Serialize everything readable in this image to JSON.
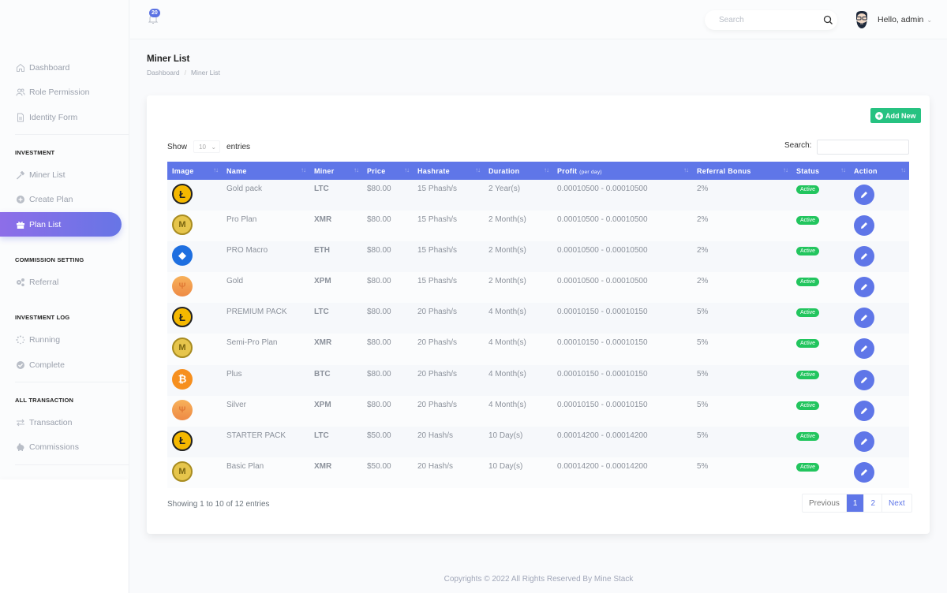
{
  "sidebar": {
    "top_items": [
      {
        "label": "Dashboard",
        "icon": "home-icon"
      },
      {
        "label": "Role Permission",
        "icon": "users-icon"
      },
      {
        "label": "Identity Form",
        "icon": "file-icon"
      }
    ],
    "sections": [
      {
        "title": "INVESTMENT",
        "items": [
          {
            "label": "Miner List",
            "icon": "hammer-icon"
          },
          {
            "label": "Create Plan",
            "icon": "plus-circle-icon"
          },
          {
            "label": "Plan List",
            "icon": "gift-icon",
            "active": true
          }
        ]
      },
      {
        "title": "COMMISSION SETTING",
        "items": [
          {
            "label": "Referral",
            "icon": "cogs-icon"
          }
        ]
      },
      {
        "title": "INVESTMENT LOG",
        "items": [
          {
            "label": "Running",
            "icon": "spinner-icon"
          },
          {
            "label": "Complete",
            "icon": "check-circle-icon"
          }
        ]
      },
      {
        "title": "ALL TRANSACTION",
        "items": [
          {
            "label": "Transaction",
            "icon": "exchange-icon"
          },
          {
            "label": "Commissions",
            "icon": "piggy-bank-icon"
          }
        ]
      }
    ]
  },
  "topbar": {
    "notification_count": "20",
    "search_placeholder": "Search",
    "greeting": "Hello, admin"
  },
  "page": {
    "title": "Miner List",
    "breadcrumb": [
      "Dashboard",
      "Miner List"
    ]
  },
  "card": {
    "add_new_label": "Add New",
    "show_label": "Show",
    "entries_label": "entries",
    "page_size": "10",
    "search_label": "Search:",
    "columns": [
      {
        "label": "Image"
      },
      {
        "label": "Name"
      },
      {
        "label": "Miner"
      },
      {
        "label": "Price"
      },
      {
        "label": "Hashrate"
      },
      {
        "label": "Duration"
      },
      {
        "label": "Profit",
        "sub": "(per day)"
      },
      {
        "label": "Referral Bonus"
      },
      {
        "label": "Status"
      },
      {
        "label": "Action"
      }
    ],
    "rows": [
      {
        "coin": "ltc",
        "name": "Gold pack",
        "miner": "LTC",
        "price": "$80.00",
        "hashrate": "15 Phash/s",
        "duration": "2 Year(s)",
        "profit": "0.00010500 - 0.00010500",
        "bonus": "2%",
        "status": "Active"
      },
      {
        "coin": "xmr",
        "name": "Pro Plan",
        "miner": "XMR",
        "price": "$80.00",
        "hashrate": "15 Phash/s",
        "duration": "2 Month(s)",
        "profit": "0.00010500 - 0.00010500",
        "bonus": "2%",
        "status": "Active"
      },
      {
        "coin": "eth",
        "name": "PRO Macro",
        "miner": "ETH",
        "price": "$80.00",
        "hashrate": "15 Phash/s",
        "duration": "2 Month(s)",
        "profit": "0.00010500 - 0.00010500",
        "bonus": "2%",
        "status": "Active"
      },
      {
        "coin": "xpm",
        "name": "Gold",
        "miner": "XPM",
        "price": "$80.00",
        "hashrate": "15 Phash/s",
        "duration": "2 Month(s)",
        "profit": "0.00010500 - 0.00010500",
        "bonus": "2%",
        "status": "Active"
      },
      {
        "coin": "ltc",
        "name": "PREMIUM PACK",
        "miner": "LTC",
        "price": "$80.00",
        "hashrate": "20 Phash/s",
        "duration": "4 Month(s)",
        "profit": "0.00010150 - 0.00010150",
        "bonus": "5%",
        "status": "Active"
      },
      {
        "coin": "xmr",
        "name": "Semi-Pro Plan",
        "miner": "XMR",
        "price": "$80.00",
        "hashrate": "20 Phash/s",
        "duration": "4 Month(s)",
        "profit": "0.00010150 - 0.00010150",
        "bonus": "5%",
        "status": "Active"
      },
      {
        "coin": "btc",
        "name": "Plus",
        "miner": "BTC",
        "price": "$80.00",
        "hashrate": "20 Phash/s",
        "duration": "4 Month(s)",
        "profit": "0.00010150 - 0.00010150",
        "bonus": "5%",
        "status": "Active"
      },
      {
        "coin": "xpm",
        "name": "Silver",
        "miner": "XPM",
        "price": "$80.00",
        "hashrate": "20 Phash/s",
        "duration": "4 Month(s)",
        "profit": "0.00010150 - 0.00010150",
        "bonus": "5%",
        "status": "Active"
      },
      {
        "coin": "ltc",
        "name": "STARTER PACK",
        "miner": "LTC",
        "price": "$50.00",
        "hashrate": "20 Hash/s",
        "duration": "10 Day(s)",
        "profit": "0.00014200 - 0.00014200",
        "bonus": "5%",
        "status": "Active"
      },
      {
        "coin": "xmr",
        "name": "Basic Plan",
        "miner": "XMR",
        "price": "$50.00",
        "hashrate": "20 Hash/s",
        "duration": "10 Day(s)",
        "profit": "0.00014200 - 0.00014200",
        "bonus": "5%",
        "status": "Active"
      }
    ],
    "info": "Showing 1 to 10 of 12 entries",
    "pagination": {
      "previous": "Previous",
      "pages": [
        "1",
        "2"
      ],
      "current": "1",
      "next": "Next"
    }
  },
  "coin_glyphs": {
    "ltc": "Ł",
    "xmr": "M",
    "eth": "◆",
    "xpm": "Ψ",
    "btc": "₿"
  },
  "colors": {
    "accent": "#5f76e8",
    "success": "#22c55e",
    "add_button": "#26c281"
  },
  "footer": "Copyrights © 2022 All Rights Reserved By Mine Stack"
}
